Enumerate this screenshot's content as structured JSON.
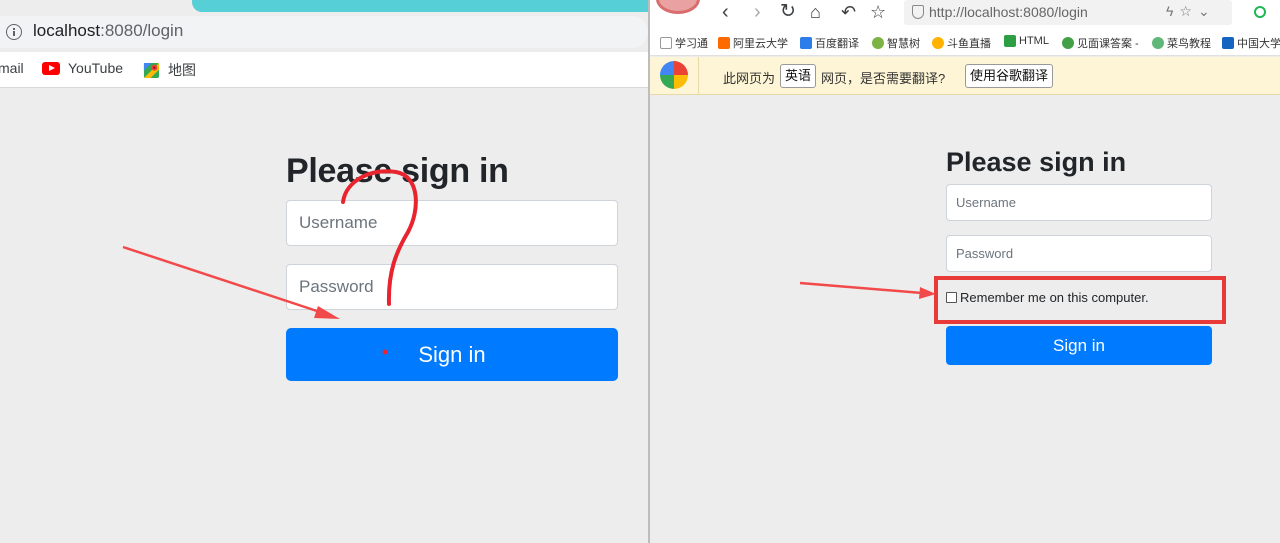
{
  "left_browser": {
    "address_bar": {
      "host": "localhost",
      "port": ":8080/login"
    },
    "bookmarks": [
      "mail",
      "YouTube",
      "地图"
    ],
    "form": {
      "title": "Please sign in",
      "username_placeholder": "Username",
      "password_placeholder": "Password",
      "submit_label": "Sign in"
    }
  },
  "right_browser": {
    "address_bar": {
      "url": "http://localhost:8080/login"
    },
    "partial_tab_text": "",
    "bookmarks": [
      "学习通",
      "阿里云大学",
      "百度翻译",
      "智慧树",
      "斗鱼直播",
      "HTML",
      "见面课答案 -",
      "菜鸟教程",
      "中国大学"
    ],
    "translate_bar": {
      "prefix": "此网页为",
      "language": "英语",
      "suffix": "网页，是否需要翻译?",
      "action_label": "使用谷歌翻译"
    },
    "form": {
      "title": "Please sign in",
      "username_placeholder": "Username",
      "password_placeholder": "Password",
      "remember_label": "Remember me on this computer.",
      "remember_checked": false,
      "submit_label": "Sign in"
    }
  },
  "annotation_colors": {
    "arrow": "#f24a4a",
    "highlight": "#e93a3a",
    "scribble": "#e8242f"
  }
}
